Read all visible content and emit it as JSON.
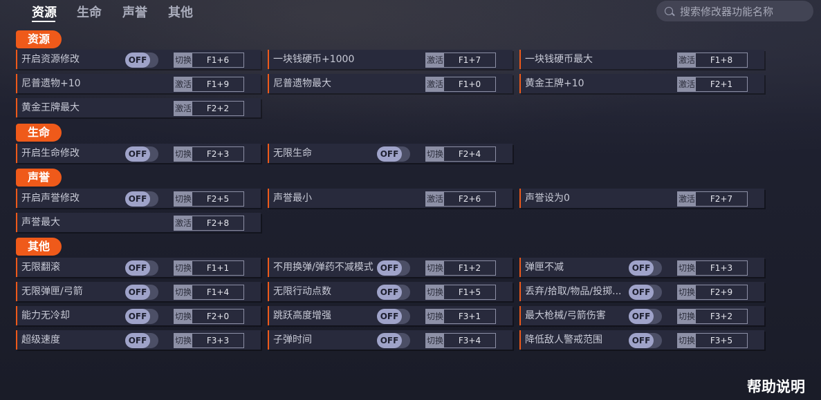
{
  "nav": {
    "tabs": [
      {
        "label": "资源"
      },
      {
        "label": "生命"
      },
      {
        "label": "声誉"
      },
      {
        "label": "其他"
      }
    ],
    "active_tab": "资源",
    "search_placeholder": "搜索修改器功能名称"
  },
  "colors": {
    "accent": "#ef5a1a",
    "row_bg": "#282a3c",
    "toggle_knob": "#9fa3c9"
  },
  "sections": {
    "resources": {
      "title": "资源",
      "items": [
        {
          "label": "开启资源修改",
          "toggle": "OFF",
          "action": "切换",
          "hotkey": "F1+6"
        },
        {
          "label": "一块钱硬币+1000",
          "action": "激活",
          "hotkey": "F1+7"
        },
        {
          "label": "一块钱硬币最大",
          "action": "激活",
          "hotkey": "F1+8"
        },
        {
          "label": "尼普遗物+10",
          "action": "激活",
          "hotkey": "F1+9"
        },
        {
          "label": "尼普遗物最大",
          "action": "激活",
          "hotkey": "F1+0"
        },
        {
          "label": "黄金王牌+10",
          "action": "激活",
          "hotkey": "F2+1"
        },
        {
          "label": "黄金王牌最大",
          "action": "激活",
          "hotkey": "F2+2"
        }
      ]
    },
    "life": {
      "title": "生命",
      "items": [
        {
          "label": "开启生命修改",
          "toggle": "OFF",
          "action": "切换",
          "hotkey": "F2+3"
        },
        {
          "label": "无限生命",
          "toggle": "OFF",
          "action": "切换",
          "hotkey": "F2+4"
        }
      ]
    },
    "reputation": {
      "title": "声誉",
      "items": [
        {
          "label": "开启声誉修改",
          "toggle": "OFF",
          "action": "切换",
          "hotkey": "F2+5"
        },
        {
          "label": "声誉最小",
          "action": "激活",
          "hotkey": "F2+6"
        },
        {
          "label": "声誉设为0",
          "action": "激活",
          "hotkey": "F2+7"
        },
        {
          "label": "声誉最大",
          "action": "激活",
          "hotkey": "F2+8"
        }
      ]
    },
    "other": {
      "title": "其他",
      "items": [
        {
          "label": "无限翻滚",
          "toggle": "OFF",
          "action": "切换",
          "hotkey": "F1+1"
        },
        {
          "label": "不用换弹/弹药不减模式",
          "toggle": "OFF",
          "action": "切换",
          "hotkey": "F1+2"
        },
        {
          "label": "弹匣不减",
          "toggle": "OFF",
          "action": "切换",
          "hotkey": "F1+3"
        },
        {
          "label": "无限弹匣/弓箭",
          "toggle": "OFF",
          "action": "切换",
          "hotkey": "F1+4"
        },
        {
          "label": "无限行动点数",
          "toggle": "OFF",
          "action": "切换",
          "hotkey": "F1+5"
        },
        {
          "label": "丢弃/拾取/物品/投掷...",
          "toggle": "OFF",
          "action": "切换",
          "hotkey": "F2+9"
        },
        {
          "label": "能力无冷却",
          "toggle": "OFF",
          "action": "切换",
          "hotkey": "F2+0"
        },
        {
          "label": "跳跃高度增强",
          "toggle": "OFF",
          "action": "切换",
          "hotkey": "F3+1"
        },
        {
          "label": "最大枪械/弓箭伤害",
          "toggle": "OFF",
          "action": "切换",
          "hotkey": "F3+2"
        },
        {
          "label": "超级速度",
          "toggle": "OFF",
          "action": "切换",
          "hotkey": "F3+3"
        },
        {
          "label": "子弹时间",
          "toggle": "OFF",
          "action": "切换",
          "hotkey": "F3+4"
        },
        {
          "label": "降低敌人警戒范围",
          "toggle": "OFF",
          "action": "切换",
          "hotkey": "F3+5"
        }
      ]
    }
  },
  "help_label": "帮助说明"
}
